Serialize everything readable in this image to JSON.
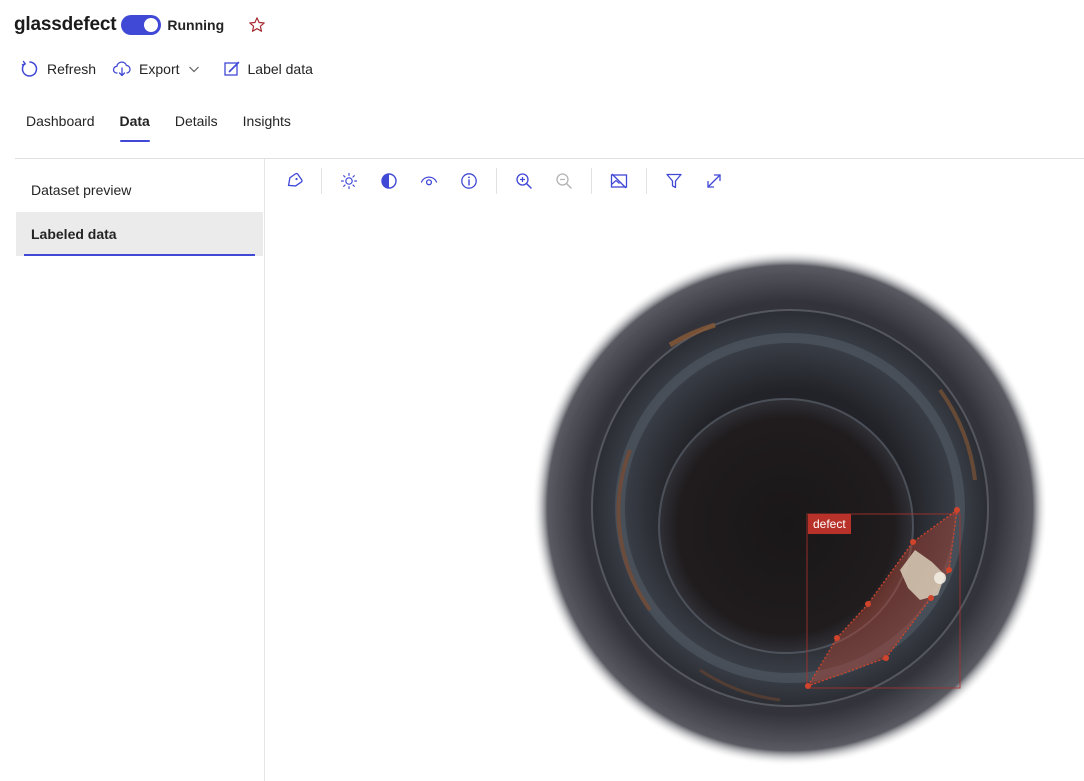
{
  "header": {
    "title": "glassdefect",
    "status": "Running",
    "toggle_on": true
  },
  "commands": {
    "refresh": "Refresh",
    "export": "Export",
    "label_data": "Label data"
  },
  "tabs": [
    {
      "label": "Dashboard",
      "active": false
    },
    {
      "label": "Data",
      "active": true
    },
    {
      "label": "Details",
      "active": false
    },
    {
      "label": "Insights",
      "active": false
    }
  ],
  "sidebar": {
    "items": [
      {
        "label": "Dataset preview",
        "active": false
      },
      {
        "label": "Labeled data",
        "active": true
      }
    ]
  },
  "toolbar": {
    "icons": [
      "tag-icon",
      "brightness-icon",
      "contrast-icon",
      "eye-icon",
      "info-icon",
      "zoom-in-icon",
      "zoom-out-icon",
      "hide-image-icon",
      "filter-icon",
      "expand-icon"
    ]
  },
  "annotation": {
    "label": "defect"
  },
  "colors": {
    "accent": "#4048d6",
    "annotation": "#c0392b",
    "star": "#a4262c"
  }
}
